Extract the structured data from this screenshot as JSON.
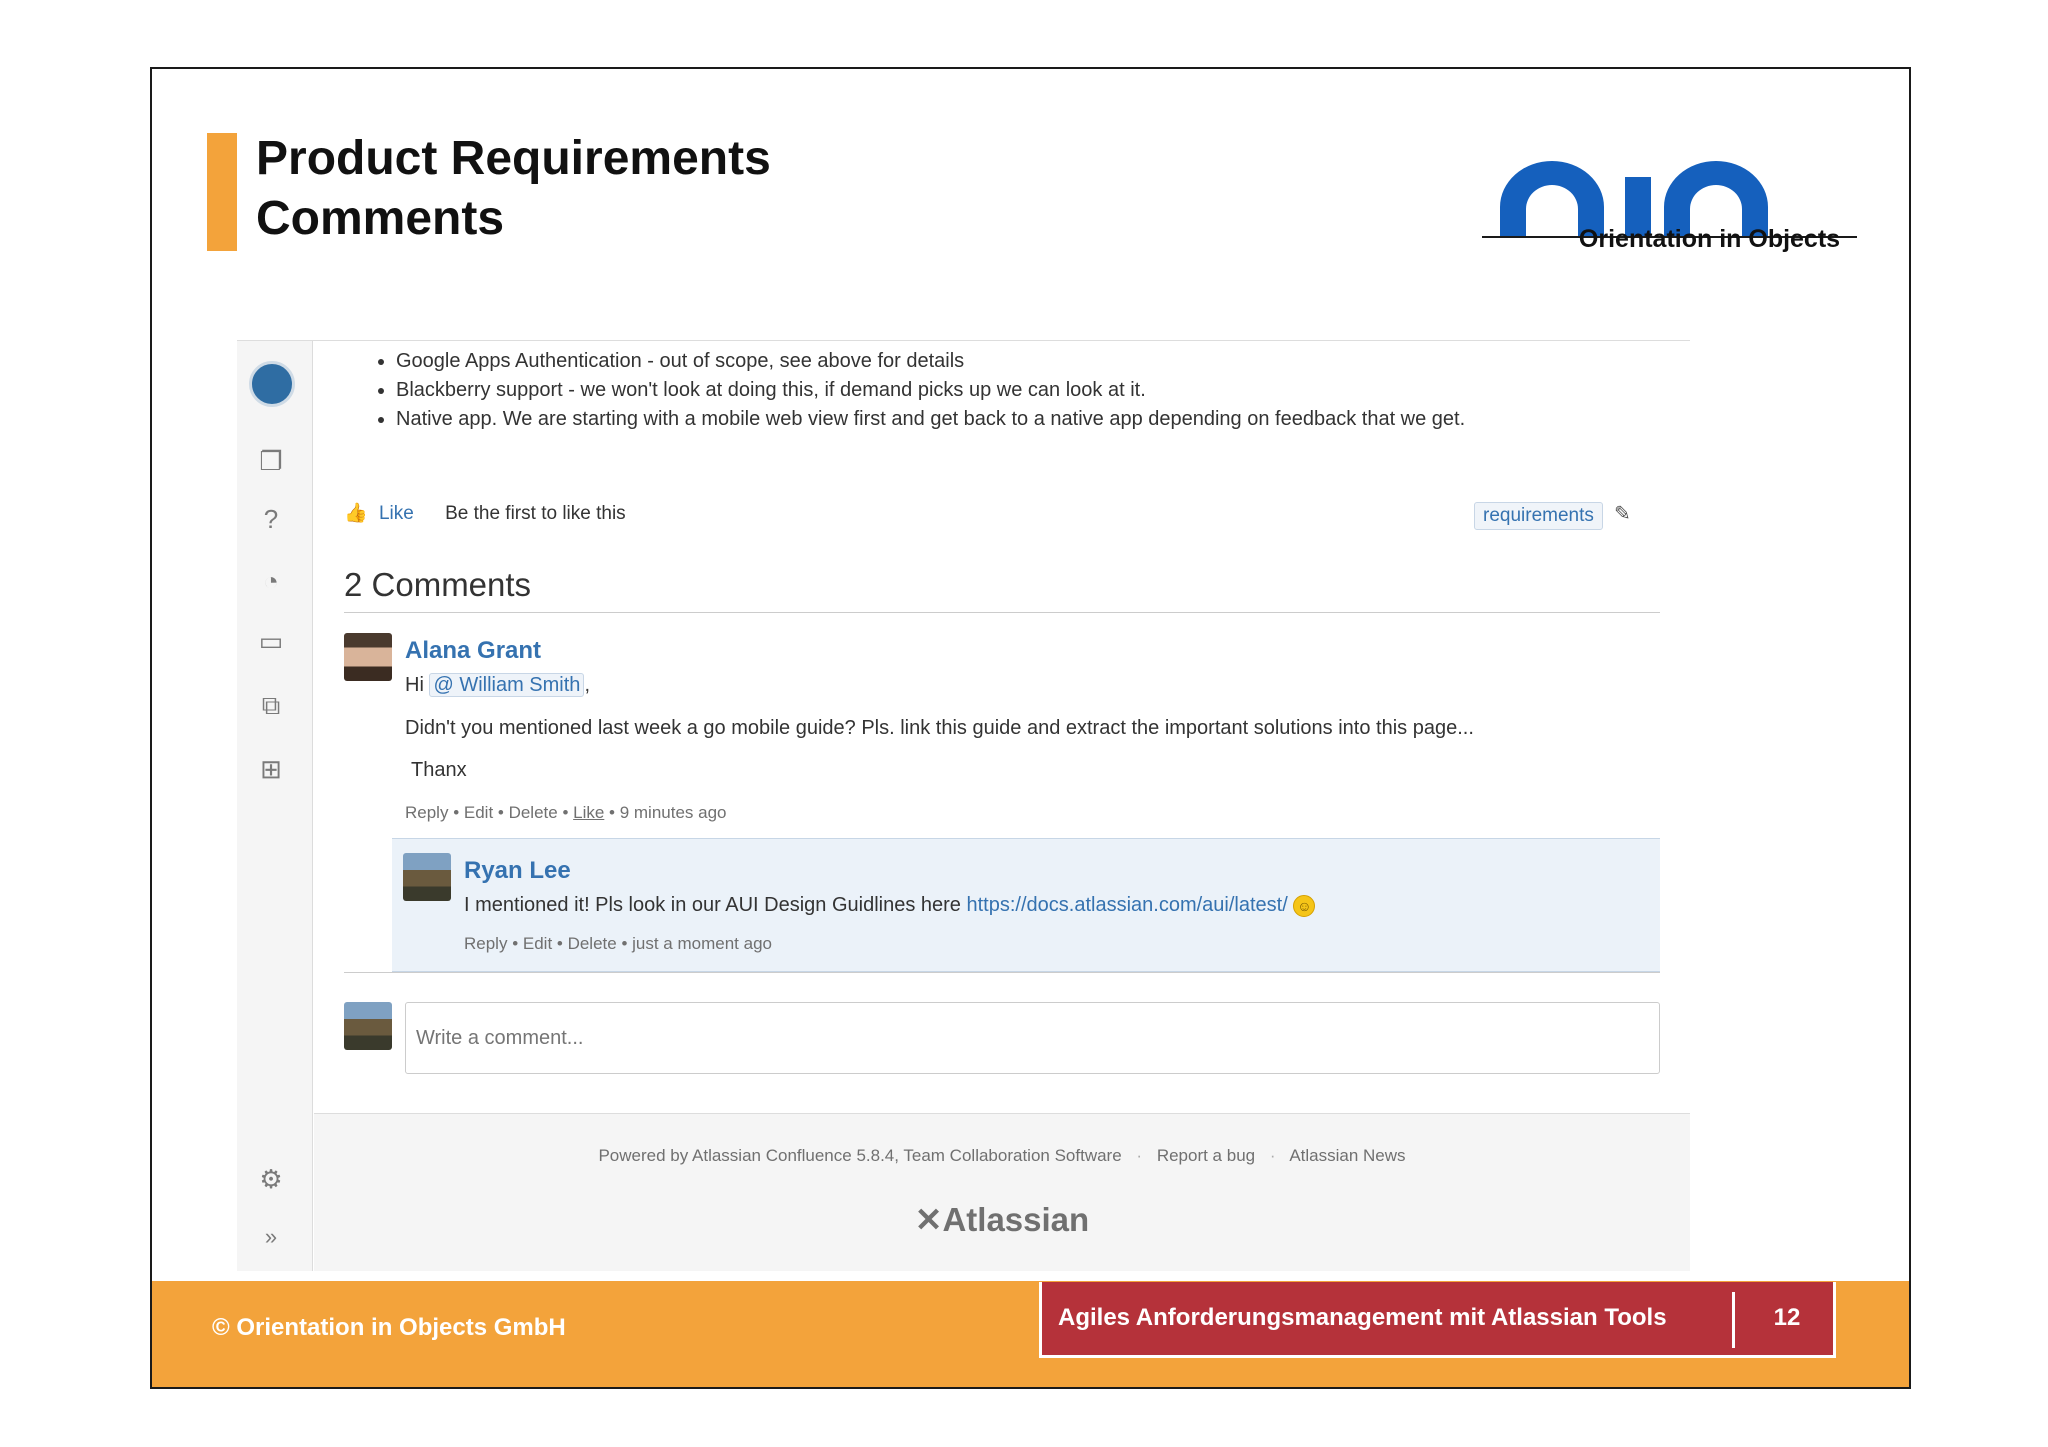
{
  "slide": {
    "title_line1": "Product Requirements",
    "title_line2": "Comments",
    "logo_text": "Orientation in Objects",
    "logo_color": "#1560bd",
    "accent_color": "#f3a33b"
  },
  "sidebar": {
    "icons": [
      "space-logo-icon",
      "pages-icon",
      "questions-icon",
      "feed-icon",
      "calendar-icon",
      "shortcuts-icon",
      "tree-icon",
      "gear-icon",
      "expand-icon"
    ]
  },
  "page": {
    "bullets": [
      "Google Apps Authentication - out of scope, see above for details",
      "Blackberry support - we won't look at doing this, if demand picks up we can look at it.",
      "Native app. We are starting with a mobile web view first and get back to a native app depending on feedback that we get."
    ],
    "like_label": "Like",
    "like_text": "Be the first to like this",
    "label_tag": "requirements"
  },
  "comments": {
    "heading": "2 Comments",
    "items": [
      {
        "author": "Alana Grant",
        "greeting": "Hi",
        "mention": "@ William Smith",
        "body": "Didn't you mentioned last week a go mobile guide? Pls. link this guide and extract the important solutions into this page...",
        "closing": "Thanx",
        "actions": [
          "Reply",
          "Edit",
          "Delete",
          "Like"
        ],
        "time": "9 minutes ago"
      },
      {
        "author": "Ryan Lee",
        "body": "I mentioned it! Pls look in our AUI Design Guidlines here",
        "link": "https://docs.atlassian.com/aui/latest/",
        "actions": [
          "Reply",
          "Edit",
          "Delete"
        ],
        "time": "just a moment ago"
      }
    ],
    "input_placeholder": "Write a comment..."
  },
  "footer": {
    "powered": "Powered by Atlassian Confluence 5.8.4, Team Collaboration Software",
    "report": "Report a bug",
    "news": "Atlassian News",
    "brand": "Atlassian"
  },
  "bottom": {
    "copyright": "© Orientation in Objects GmbH",
    "course_title": "Agiles Anforderungsmanagement mit Atlassian Tools",
    "page_number": "12"
  }
}
